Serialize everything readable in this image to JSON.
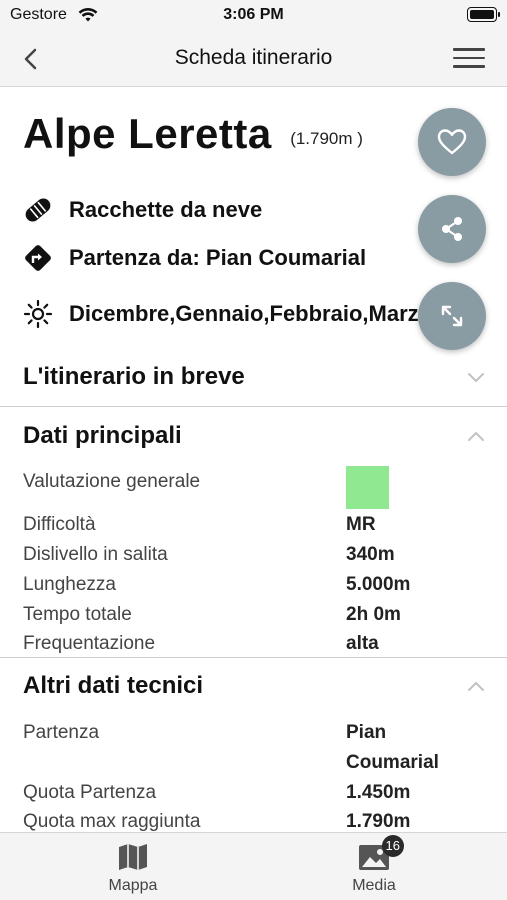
{
  "status_bar": {
    "carrier": "Gestore",
    "time": "3:06 PM"
  },
  "nav": {
    "title": "Scheda itinerario",
    "back_icon": "chevron-left-icon",
    "menu_icon": "hamburger-menu-icon"
  },
  "route": {
    "name": "Alpe Leretta",
    "altitude": "(1.790m )",
    "activity": "Racchette da neve",
    "start": "Partenza da: Pian Coumarial",
    "months": "Dicembre,Gennaio,Febbraio,Marzo"
  },
  "actions": {
    "favorite_icon": "heart-icon",
    "share_icon": "share-icon",
    "expand_icon": "expand-arrows-icon"
  },
  "sections": {
    "summary": {
      "title": "L'itinerario in breve",
      "expanded": false
    },
    "main_data": {
      "title": "Dati principali",
      "expanded": true,
      "rating_label": "Valutazione generale",
      "rating_color": "#90e890",
      "rows": [
        {
          "label": "Difficoltà",
          "value": "MR"
        },
        {
          "label": "Dislivello in salita",
          "value": "340m"
        },
        {
          "label": "Lunghezza",
          "value": "5.000m"
        },
        {
          "label": "Tempo totale",
          "value": "2h 0m"
        },
        {
          "label": "Frequentazione",
          "value": "alta"
        }
      ]
    },
    "technical_data": {
      "title": "Altri dati tecnici",
      "expanded": true,
      "rows": [
        {
          "label": "Partenza",
          "value_line1": "Pian",
          "value_line2": "Coumarial"
        },
        {
          "label": "Quota Partenza",
          "value": "1.450m"
        },
        {
          "label": "Quota max raggiunta",
          "value": "1.790m"
        }
      ]
    }
  },
  "tab_bar": {
    "map_label": "Mappa",
    "media_label": "Media",
    "media_badge": "16"
  },
  "colors": {
    "fab": "#8a9ca3",
    "bar_background": "#f4f4f4"
  }
}
